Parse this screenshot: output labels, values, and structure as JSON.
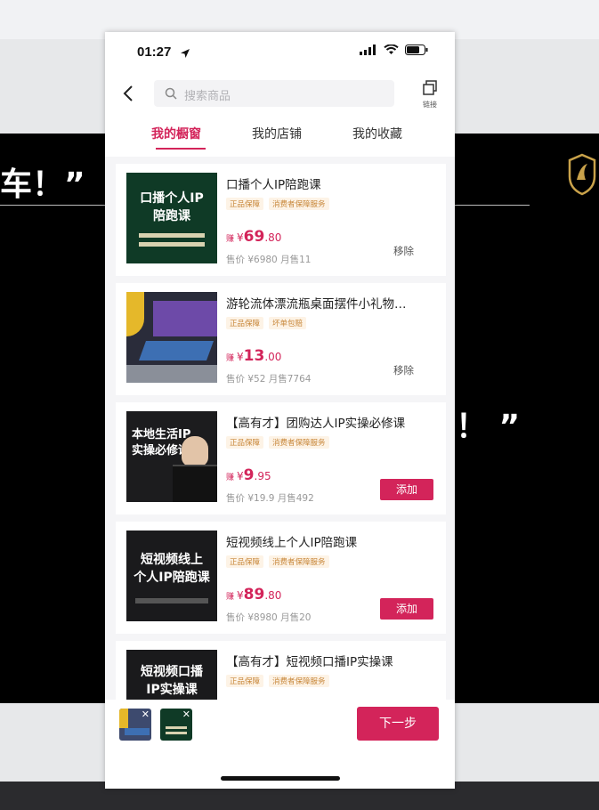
{
  "status_bar": {
    "time": "01:27"
  },
  "nav": {
    "search_placeholder": "搜索商品",
    "link_label": "链接"
  },
  "tabs": [
    {
      "label": "我的橱窗",
      "active": true
    },
    {
      "label": "我的店铺",
      "active": false
    },
    {
      "label": "我的收藏",
      "active": false
    }
  ],
  "products": [
    {
      "title": "口播个人IP陪跑课",
      "tags": [
        "正品保障",
        "消费者保障服务"
      ],
      "earn_label": "赚",
      "currency": "¥",
      "earn_int": "69",
      "earn_dec": ".80",
      "meta": "售价 ¥6980  月售11",
      "action": "移除",
      "thumb_text": [
        "口播个人IP",
        "陪跑课"
      ]
    },
    {
      "title": "游轮流体漂流瓶桌面摆件小礼物…",
      "tags": [
        "正品保障",
        "坏单包赔"
      ],
      "earn_label": "赚",
      "currency": "¥",
      "earn_int": "13",
      "earn_dec": ".00",
      "meta": "售价 ¥52  月售7764",
      "action": "移除",
      "thumb_text": []
    },
    {
      "title": "【高有才】团购达人IP实操必修课",
      "tags": [
        "正品保障",
        "消费者保障服务"
      ],
      "earn_label": "赚",
      "currency": "¥",
      "earn_int": "9",
      "earn_dec": ".95",
      "meta": "售价 ¥19.9  月售492",
      "action": "添加",
      "thumb_text": [
        "本地生活IP",
        "实操必修课"
      ]
    },
    {
      "title": "短视频线上个人IP陪跑课",
      "tags": [
        "正品保障",
        "消费者保障服务"
      ],
      "earn_label": "赚",
      "currency": "¥",
      "earn_int": "89",
      "earn_dec": ".80",
      "meta": "售价 ¥8980  月售20",
      "action": "添加",
      "thumb_text": [
        "短视频线上",
        "个人IP陪跑课"
      ]
    },
    {
      "title": "【高有才】短视频口播IP实操课",
      "tags": [
        "正品保障",
        "消费者保障服务"
      ],
      "thumb_text": [
        "短视频口播",
        "IP实操课"
      ]
    }
  ],
  "footer": {
    "next_label": "下一步"
  },
  "background": {
    "slide_text_1": "车！”",
    "slide_text_2": "！ ”"
  },
  "colors": {
    "accent": "#d3245a",
    "tag_bg": "#fdf3e6",
    "tag_text": "#c8873a"
  }
}
